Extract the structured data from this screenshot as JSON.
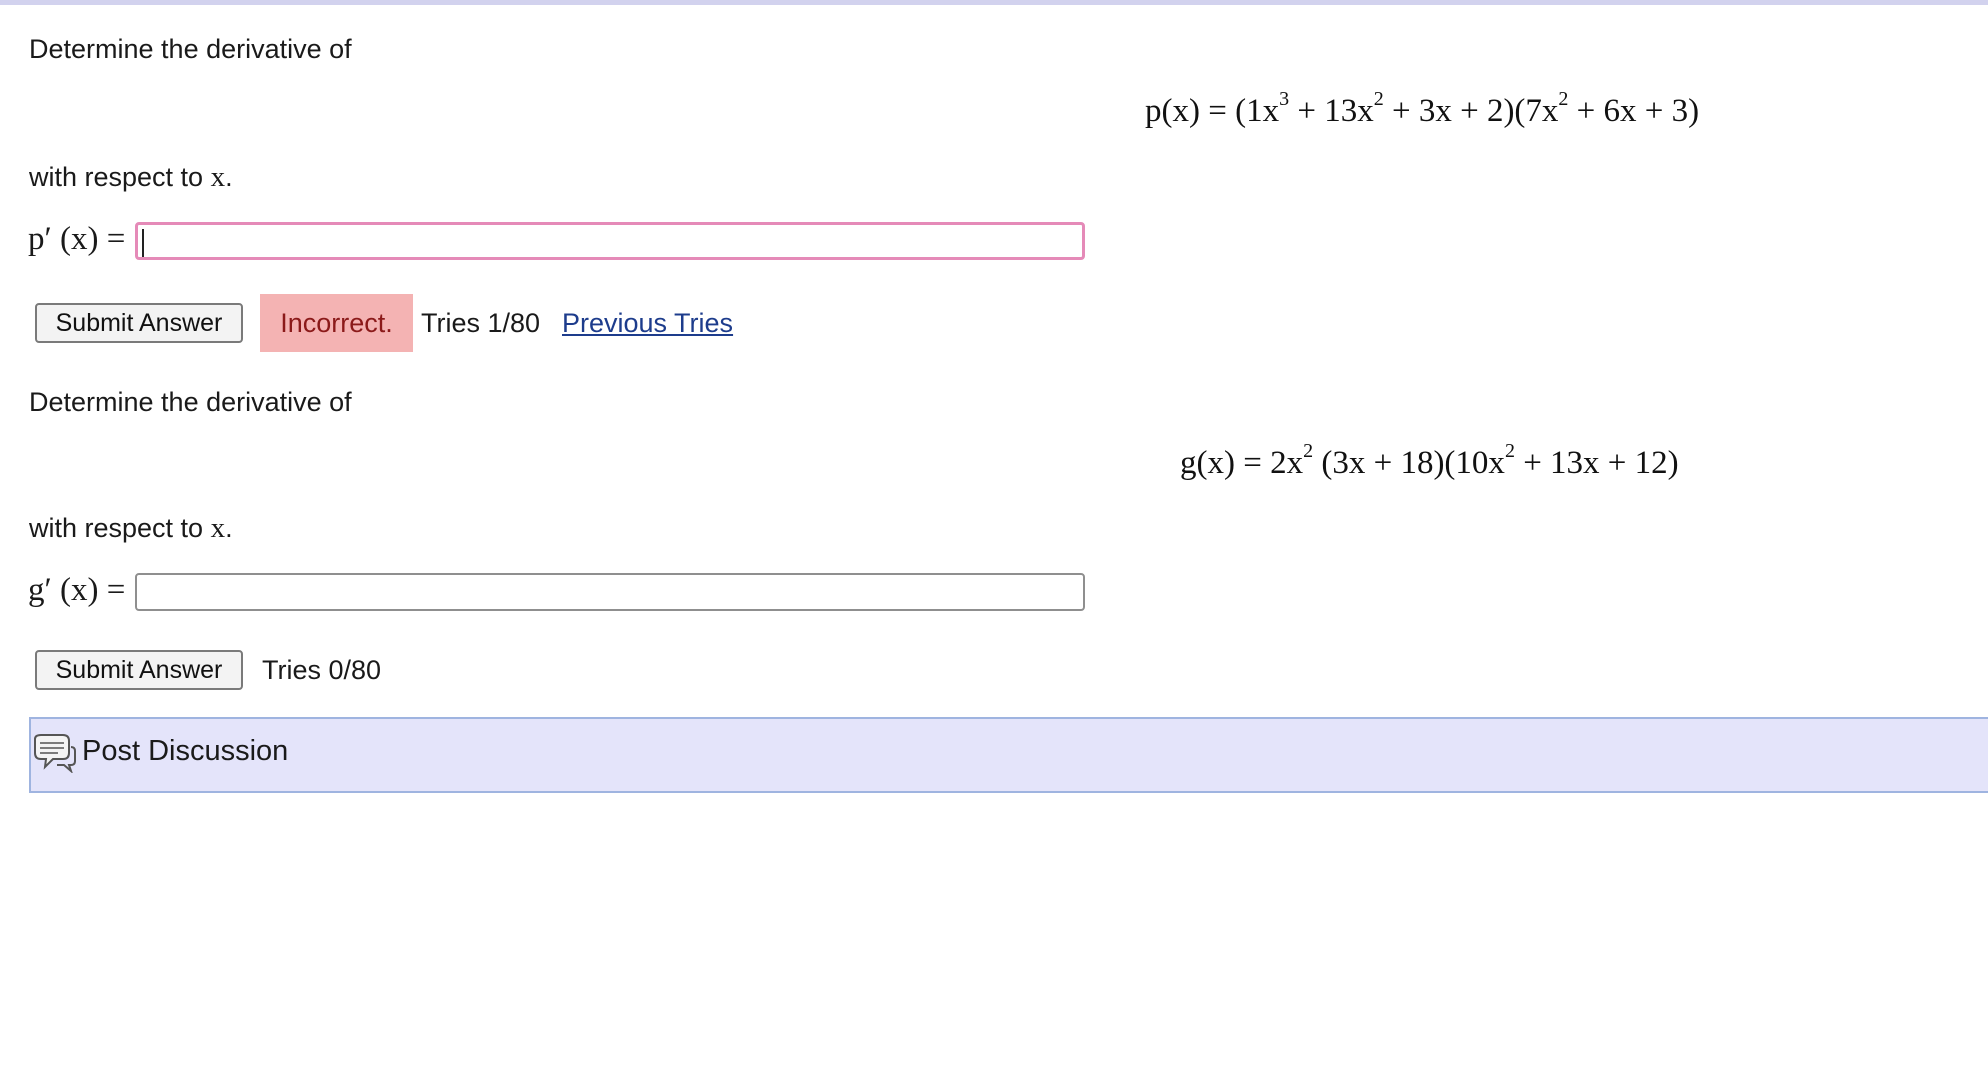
{
  "problems": [
    {
      "prompt": "Determine the derivative of",
      "function_name": "p(x) = (1x",
      "formula_parts": [
        "p(x) = (1x",
        "3",
        " + 13x",
        "2",
        " + 3x + 2)(7x",
        "2",
        " + 6x + 3)"
      ],
      "respect_prefix": "with respect to ",
      "variable": "x",
      "respect_suffix": ".",
      "answer_label": "p′ (x) =",
      "answer_value": "",
      "submit_label": "Submit Answer",
      "status": "Incorrect.",
      "tries": "Tries 1/80",
      "previous_tries_link": "Previous Tries"
    },
    {
      "prompt": "Determine the derivative of",
      "formula_parts": [
        "g(x) = 2x",
        "2",
        " (3x + 18)(10x",
        "2",
        " + 13x + 12)"
      ],
      "respect_prefix": "with respect to ",
      "variable": "x",
      "respect_suffix": ".",
      "answer_label": "g′ (x) =",
      "answer_value": "",
      "submit_label": "Submit Answer",
      "tries": "Tries 0/80"
    }
  ],
  "discussion": {
    "label": "Post Discussion",
    "icon": "speech-bubble-icon"
  },
  "colors": {
    "incorrect_bg": "#f4b3b3",
    "incorrect_text": "#8b1a1a",
    "focus_border": "#e58ab8",
    "link": "#1d3c8c",
    "discussion_bg": "#e4e4fa"
  }
}
